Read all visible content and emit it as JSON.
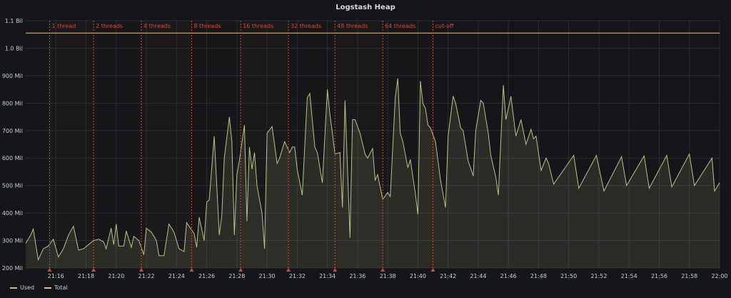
{
  "panel": {
    "title": "Logstash Heap"
  },
  "colors": {
    "used": "#b7c28d",
    "total": "#e5c27a",
    "annotation": "#d44a3a",
    "grid": "#2a2d31",
    "text": "#c7d0d9"
  },
  "chart_data": {
    "type": "line",
    "title": "Logstash Heap",
    "xlabel": "",
    "ylabel": "",
    "xlim": [
      "21:14",
      "22:00"
    ],
    "ylim": [
      200,
      1100
    ],
    "y_unit": "Mil",
    "y_ticks": [
      200,
      300,
      400,
      500,
      600,
      700,
      800,
      900,
      1000,
      1100
    ],
    "y_tick_labels": [
      "200 Mil",
      "300 Mil",
      "400 Mil",
      "500 Mil",
      "600 Mil",
      "700 Mil",
      "800 Mil",
      "900 Mil",
      "1.0 Bil",
      "1.1 Bil"
    ],
    "x_ticks": [
      "21:16",
      "21:18",
      "21:20",
      "21:22",
      "21:24",
      "21:26",
      "21:28",
      "21:30",
      "21:32",
      "21:34",
      "21:36",
      "21:38",
      "21:40",
      "21:42",
      "21:44",
      "21:46",
      "21:48",
      "21:50",
      "21:52",
      "21:54",
      "21:56",
      "21:58",
      "22:00"
    ],
    "grid": true,
    "legend": "bottom-left",
    "annotations": [
      {
        "time": "21:15:35",
        "label": "1 thread"
      },
      {
        "time": "21:18:30",
        "label": "2 threads"
      },
      {
        "time": "21:21:40",
        "label": "4 threads"
      },
      {
        "time": "21:25:00",
        "label": "8 threads"
      },
      {
        "time": "21:28:15",
        "label": "16 threads"
      },
      {
        "time": "21:31:25",
        "label": "32 threads"
      },
      {
        "time": "21:34:30",
        "label": "48 threads"
      },
      {
        "time": "21:37:40",
        "label": "64 threads"
      },
      {
        "time": "21:41:00",
        "label": "cut-off"
      }
    ],
    "series": [
      {
        "name": "Used",
        "color": "#b7c28d",
        "fill": true,
        "points": [
          [
            "21:14:00",
            290
          ],
          [
            "21:14:20",
            320
          ],
          [
            "21:14:30",
            342
          ],
          [
            "21:14:50",
            230
          ],
          [
            "21:15:10",
            270
          ],
          [
            "21:15:30",
            280
          ],
          [
            "21:15:50",
            305
          ],
          [
            "21:16:10",
            240
          ],
          [
            "21:16:30",
            270
          ],
          [
            "21:16:50",
            320
          ],
          [
            "21:17:10",
            352
          ],
          [
            "21:17:30",
            265
          ],
          [
            "21:17:50",
            270
          ],
          [
            "21:18:10",
            285
          ],
          [
            "21:18:30",
            300
          ],
          [
            "21:18:50",
            305
          ],
          [
            "21:19:10",
            295
          ],
          [
            "21:19:20",
            270
          ],
          [
            "21:19:40",
            345
          ],
          [
            "21:19:50",
            285
          ],
          [
            "21:20:00",
            360
          ],
          [
            "21:20:10",
            280
          ],
          [
            "21:20:30",
            280
          ],
          [
            "21:20:40",
            335
          ],
          [
            "21:21:00",
            275
          ],
          [
            "21:21:10",
            315
          ],
          [
            "21:21:30",
            300
          ],
          [
            "21:21:50",
            248
          ],
          [
            "21:22:00",
            345
          ],
          [
            "21:22:20",
            330
          ],
          [
            "21:22:40",
            300
          ],
          [
            "21:22:50",
            245
          ],
          [
            "21:23:10",
            245
          ],
          [
            "21:23:30",
            360
          ],
          [
            "21:23:50",
            330
          ],
          [
            "21:24:10",
            270
          ],
          [
            "21:24:30",
            260
          ],
          [
            "21:24:40",
            365
          ],
          [
            "21:25:10",
            325
          ],
          [
            "21:25:20",
            275
          ],
          [
            "21:25:30",
            385
          ],
          [
            "21:25:50",
            300
          ],
          [
            "21:26:00",
            440
          ],
          [
            "21:26:10",
            448
          ],
          [
            "21:26:30",
            680
          ],
          [
            "21:26:50",
            320
          ],
          [
            "21:27:00",
            390
          ],
          [
            "21:27:10",
            600
          ],
          [
            "21:27:30",
            750
          ],
          [
            "21:27:40",
            660
          ],
          [
            "21:27:50",
            320
          ],
          [
            "21:28:00",
            540
          ],
          [
            "21:28:10",
            590
          ],
          [
            "21:28:30",
            720
          ],
          [
            "21:28:40",
            370
          ],
          [
            "21:28:50",
            640
          ],
          [
            "21:29:00",
            560
          ],
          [
            "21:29:10",
            620
          ],
          [
            "21:29:20",
            500
          ],
          [
            "21:29:40",
            400
          ],
          [
            "21:29:50",
            270
          ],
          [
            "21:30:00",
            690
          ],
          [
            "21:30:20",
            715
          ],
          [
            "21:30:40",
            580
          ],
          [
            "21:30:50",
            600
          ],
          [
            "21:31:10",
            660
          ],
          [
            "21:31:30",
            620
          ],
          [
            "21:31:40",
            640
          ],
          [
            "21:31:50",
            640
          ],
          [
            "21:32:00",
            560
          ],
          [
            "21:32:20",
            465
          ],
          [
            "21:32:40",
            820
          ],
          [
            "21:32:50",
            835
          ],
          [
            "21:33:10",
            640
          ],
          [
            "21:33:20",
            620
          ],
          [
            "21:33:40",
            510
          ],
          [
            "21:34:00",
            850
          ],
          [
            "21:34:10",
            760
          ],
          [
            "21:34:20",
            690
          ],
          [
            "21:34:30",
            615
          ],
          [
            "21:34:50",
            620
          ],
          [
            "21:35:00",
            420
          ],
          [
            "21:35:10",
            810
          ],
          [
            "21:35:30",
            310
          ],
          [
            "21:35:40",
            740
          ],
          [
            "21:35:50",
            740
          ],
          [
            "21:36:10",
            690
          ],
          [
            "21:36:30",
            615
          ],
          [
            "21:36:40",
            600
          ],
          [
            "21:37:00",
            635
          ],
          [
            "21:37:10",
            520
          ],
          [
            "21:37:20",
            540
          ],
          [
            "21:37:40",
            450
          ],
          [
            "21:38:00",
            475
          ],
          [
            "21:38:10",
            460
          ],
          [
            "21:38:30",
            820
          ],
          [
            "21:38:40",
            890
          ],
          [
            "21:38:50",
            690
          ],
          [
            "21:39:00",
            660
          ],
          [
            "21:39:20",
            565
          ],
          [
            "21:39:30",
            595
          ],
          [
            "21:39:50",
            470
          ],
          [
            "21:40:00",
            395
          ],
          [
            "21:40:10",
            880
          ],
          [
            "21:40:20",
            800
          ],
          [
            "21:40:30",
            780
          ],
          [
            "21:40:40",
            720
          ],
          [
            "21:40:50",
            710
          ],
          [
            "21:41:10",
            660
          ],
          [
            "21:41:30",
            520
          ],
          [
            "21:41:50",
            420
          ],
          [
            "21:42:00",
            680
          ],
          [
            "21:42:20",
            825
          ],
          [
            "21:42:30",
            800
          ],
          [
            "21:42:50",
            710
          ],
          [
            "21:43:00",
            700
          ],
          [
            "21:43:20",
            590
          ],
          [
            "21:43:40",
            535
          ],
          [
            "21:43:50",
            700
          ],
          [
            "21:44:10",
            810
          ],
          [
            "21:44:20",
            800
          ],
          [
            "21:44:40",
            690
          ],
          [
            "21:44:50",
            610
          ],
          [
            "21:45:10",
            530
          ],
          [
            "21:45:20",
            465
          ],
          [
            "21:45:40",
            865
          ],
          [
            "21:45:50",
            740
          ],
          [
            "21:46:10",
            825
          ],
          [
            "21:46:30",
            680
          ],
          [
            "21:46:50",
            740
          ],
          [
            "21:47:10",
            650
          ],
          [
            "21:47:30",
            705
          ],
          [
            "21:47:40",
            670
          ],
          [
            "21:47:50",
            680
          ],
          [
            "21:48:10",
            555
          ],
          [
            "21:48:30",
            600
          ],
          [
            "21:48:40",
            580
          ],
          [
            "21:49:00",
            505
          ],
          [
            "21:50:20",
            610
          ],
          [
            "21:50:40",
            490
          ],
          [
            "21:51:50",
            610
          ],
          [
            "21:52:20",
            480
          ],
          [
            "21:53:30",
            605
          ],
          [
            "21:53:50",
            500
          ],
          [
            "21:55:00",
            608
          ],
          [
            "21:55:20",
            490
          ],
          [
            "21:56:30",
            610
          ],
          [
            "21:56:50",
            495
          ],
          [
            "21:58:00",
            615
          ],
          [
            "21:58:20",
            500
          ],
          [
            "21:59:30",
            600
          ],
          [
            "21:59:40",
            480
          ],
          [
            "22:00:00",
            510
          ]
        ]
      },
      {
        "name": "Total",
        "color": "#e5c27a",
        "fill": false,
        "points": [
          [
            "21:14:00",
            1055
          ],
          [
            "22:00:00",
            1055
          ]
        ]
      }
    ]
  }
}
